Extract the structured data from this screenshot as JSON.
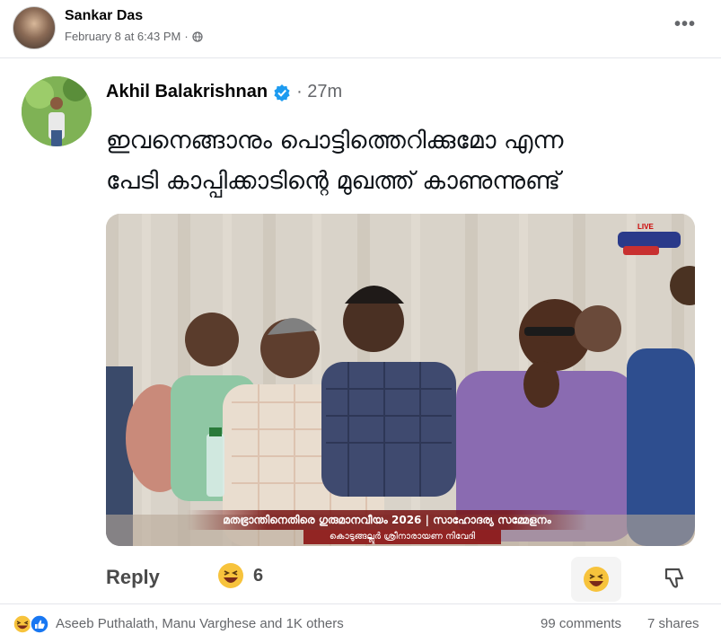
{
  "post": {
    "author": "Sankar Das",
    "date": "February 8 at 6:43 PM",
    "separator": "·",
    "privacy_icon": "globe-icon",
    "more_label": "•••"
  },
  "embed": {
    "name": "Akhil Balakrishnan",
    "verified_icon": "verified-check-icon",
    "time": "· 27m",
    "text_line1": "ഇവനെങ്ങാനും പൊട്ടിത്തെറിക്കുമോ എന്ന",
    "text_line2": "പേടി കാപ്പിക്കാടിന്റെ മുഖത്ത് കാണുന്നുണ്ട്",
    "video": {
      "live_badge": "LIVE",
      "caption_main": "മതഭ്രാന്തിനെതിരെ ഗുരുമാനവീയം 2026 | സാഹോദര്യ സമ്മേളനം",
      "caption_sub": "കൊടുങ്ങല്ലൂർ ശ്രീനാരായണ നിവേദി"
    },
    "reply_label": "Reply",
    "reaction_count": "6"
  },
  "stats": {
    "reactors": "Aseeb Puthalath, Manu Varghese and 1K others",
    "comments": "99 comments",
    "shares": "7 shares"
  },
  "colors": {
    "text_primary": "#050505",
    "text_secondary": "#65676b",
    "verified_blue": "#1d9bf0",
    "like_blue": "#1877f2",
    "haha_yellow": "#f7c33c"
  }
}
